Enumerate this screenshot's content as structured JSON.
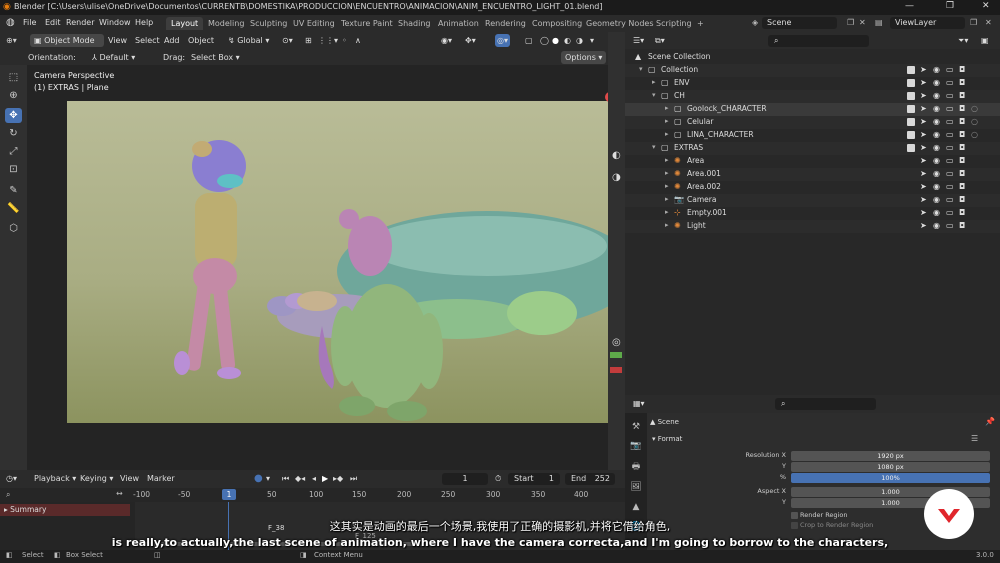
{
  "window": {
    "title": "Blender [C:\\Users\\ulise\\OneDrive\\Documentos\\CURRENTB\\DOMESTIKA\\PRODUCCION\\ENCUENTRO\\ANIMACION\\ANIM_ENCUENTRO_LIGHT_01.blend]",
    "minimize": "—",
    "maximize": "❐",
    "close": "✕"
  },
  "menu": {
    "items": [
      "File",
      "Edit",
      "Render",
      "Window",
      "Help"
    ],
    "workspaces": [
      "Layout",
      "Modeling",
      "Sculpting",
      "UV Editing",
      "Texture Paint",
      "Shading",
      "Animation",
      "Rendering",
      "Compositing",
      "Geometry Nodes",
      "Scripting"
    ],
    "add_tab": "+",
    "scene": "Scene",
    "view_layer": "ViewLayer"
  },
  "viewport_header": {
    "mode": "Object Mode",
    "menus": [
      "View",
      "Select",
      "Add",
      "Object"
    ],
    "transform": "Global",
    "orientation_label": "Orientation:",
    "orientation_value": "Default",
    "drag_label": "Drag:",
    "drag_value": "Select Box",
    "options": "Options"
  },
  "viewport": {
    "info_line1": "Camera Perspective",
    "info_line2": "(1) EXTRAS | Plane"
  },
  "outliner": {
    "search_placeholder": "",
    "rows": [
      {
        "label": "Scene Collection",
        "indent": 0,
        "kind": "scene"
      },
      {
        "label": "Collection",
        "indent": 1,
        "kind": "collection"
      },
      {
        "label": "ENV",
        "indent": 2,
        "kind": "collection"
      },
      {
        "label": "CH",
        "indent": 2,
        "kind": "collection"
      },
      {
        "label": "Goolock_CHARACTER",
        "indent": 3,
        "kind": "collection"
      },
      {
        "label": "Celular",
        "indent": 3,
        "kind": "collection"
      },
      {
        "label": "LINA_CHARACTER",
        "indent": 3,
        "kind": "collection"
      },
      {
        "label": "EXTRAS",
        "indent": 2,
        "kind": "collection"
      },
      {
        "label": "Area",
        "indent": 3,
        "kind": "light"
      },
      {
        "label": "Area.001",
        "indent": 3,
        "kind": "light"
      },
      {
        "label": "Area.002",
        "indent": 3,
        "kind": "light"
      },
      {
        "label": "Camera",
        "indent": 3,
        "kind": "camera"
      },
      {
        "label": "Empty.001",
        "indent": 3,
        "kind": "empty"
      },
      {
        "label": "Light",
        "indent": 3,
        "kind": "light"
      }
    ]
  },
  "properties": {
    "breadcrumb": "Scene",
    "panel": "Format",
    "resolution_x_label": "Resolution X",
    "resolution_x": "1920 px",
    "y_label": "Y",
    "resolution_y": "1080 px",
    "pct_label": "%",
    "resolution_pct": "100%",
    "aspect_x_label": "Aspect X",
    "aspect_x": "1.000",
    "aspect_y_label": "Y",
    "aspect_y": "1.000",
    "render_region": "Render Region",
    "crop_region": "Crop to Render Region"
  },
  "timeline": {
    "menus": [
      "Playback",
      "Keying",
      "View",
      "Marker"
    ],
    "current_frame": "1",
    "start_label": "Start",
    "start": "1",
    "end_label": "End",
    "end": "252",
    "ticks": [
      "-100",
      "-50",
      "1",
      "50",
      "100",
      "150",
      "200",
      "250",
      "300",
      "350",
      "400"
    ],
    "summary": "Summary",
    "marker_1": "F_38",
    "marker_2": "F_125"
  },
  "status": {
    "select": "Select",
    "box_select": "Box Select",
    "context_menu": "Context Menu",
    "version": "3.0.0"
  },
  "subtitles": {
    "zh": "这其实是动画的最后一个场景,我使用了正确的摄影机,并将它借给角色,",
    "en": "is really,to actually,the last scene of animation, where I have the camera correcta,and I'm going to borrow to the characters,"
  },
  "colors": {
    "accent": "#4772b3",
    "header": "#2b2b2b",
    "selected_row": "#3a3a3a",
    "frame_bg": "#a8ab85",
    "brand": "#e0262c"
  }
}
